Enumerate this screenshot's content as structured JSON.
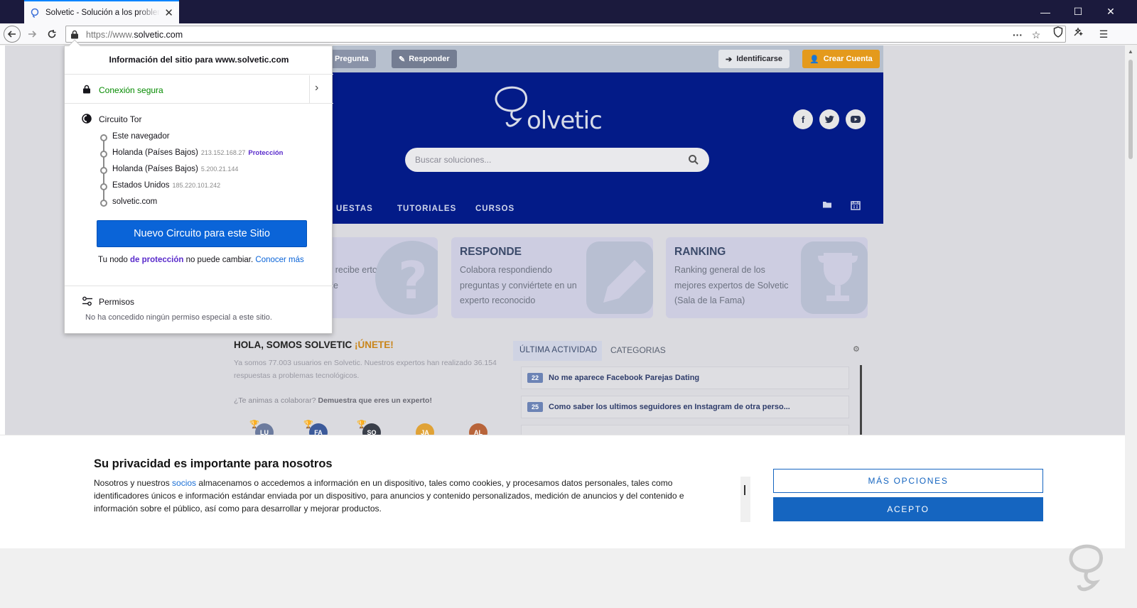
{
  "browser": {
    "tab_title": "Solvetic - Solución a los problemas",
    "url_proto": "https://www.",
    "url_domain": "solvetic.com"
  },
  "site_info": {
    "title": "Información del sitio para www.solvetic.com",
    "secure": "Conexión segura",
    "circuit_title": "Circuito Tor",
    "nodes": [
      {
        "label": "Este navegador",
        "ip": "",
        "tag": ""
      },
      {
        "label": "Holanda (Países Bajos)",
        "ip": "213.152.168.27",
        "tag": "Protección"
      },
      {
        "label": "Holanda (Países Bajos)",
        "ip": "5.200.21.144",
        "tag": ""
      },
      {
        "label": "Estados Unidos",
        "ip": "185.220.101.242",
        "tag": ""
      },
      {
        "label": "solvetic.com",
        "ip": "",
        "tag": ""
      }
    ],
    "new_circuit": "Nuevo Circuito para este Sitio",
    "guard_pre": "Tu nodo ",
    "guard_bold": "de protección",
    "guard_mid": " no puede cambiar. ",
    "guard_link": "Conocer más",
    "permissions_title": "Permisos",
    "permissions_desc": "No ha concedido ningún permiso especial a este sitio."
  },
  "site": {
    "btn_pregunta": "Pregunta",
    "btn_responder": "Responder",
    "btn_login": "Identificarse",
    "btn_signup": "Crear Cuenta",
    "logo": "olvetic",
    "search_placeholder": "Buscar soluciones...",
    "menu": [
      "UESTAS",
      "TUTORIALES",
      "CURSOS"
    ],
    "cards": [
      {
        "title": "",
        "desc": "y recibe\nertos de"
      },
      {
        "title": "RESPONDE",
        "desc": "Colabora respondiendo preguntas y conviértete en un experto reconocido"
      },
      {
        "title": "RANKING",
        "desc": "Ranking general de los mejores expertos de Solvetic (Sala de la Fama)"
      }
    ],
    "hola": "HOLA, SOMOS SOLVETIC ",
    "unete": "¡ÚNETE!",
    "hola_desc": "Ya somos 77.003 usuarios en Solvetic. Nuestros expertos han realizado 36.154 respuestas a problemas tecnológicos.",
    "anim_pre": "¿Te animas a colaborar? ",
    "anim_bold": "Demuestra que eres un experto!",
    "avatars": [
      "LU",
      "FA",
      "SO",
      "JA",
      "AL"
    ],
    "tab_ultima": "ÚLTIMA ACTIVIDAD",
    "tab_categorias": "CATEGORIAS",
    "activity": [
      {
        "num": "22",
        "text": "No me aparece Facebook Parejas Dating"
      },
      {
        "num": "25",
        "text": "Como saber los ultimos seguidores en Instagram de otra perso..."
      }
    ]
  },
  "consent": {
    "title": "Su privacidad es importante para nosotros",
    "text_pre": "Nosotros y nuestros ",
    "text_link": "socios",
    "text_post": " almacenamos o accedemos a información en un dispositivo, tales como cookies, y procesamos datos personales, tales como identificadores únicos e información estándar enviada por un dispositivo, para anuncios y contenido personalizados, medición de anuncios y del contenido e información sobre el público, así como para desarrollar y mejorar productos.",
    "more_options": "MÁS OPCIONES",
    "accept": "ACEPTO"
  },
  "colors": {
    "tabbar": "#1b1a3d",
    "site_header": "#031b88",
    "accent_blue": "#0a64d8",
    "signup_orange": "#e49a1c",
    "consent_blue": "#1565c0"
  }
}
